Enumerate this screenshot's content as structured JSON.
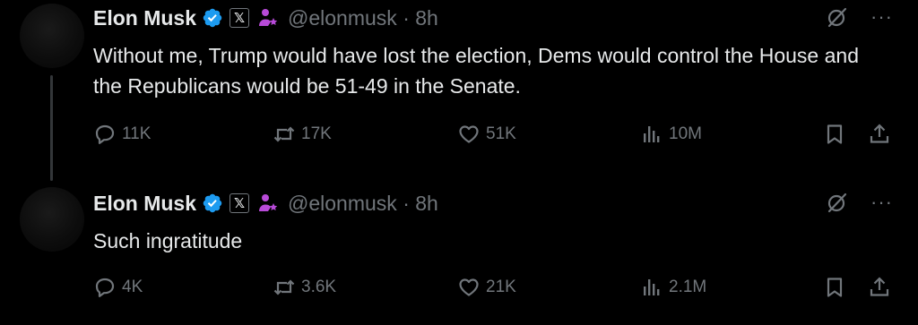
{
  "tweets": [
    {
      "author": "Elon Musk",
      "handle": "@elonmusk",
      "separator": "·",
      "time": "8h",
      "x_badge": "𝕏",
      "text": "Without me, Trump would have lost the election, Dems would control the House and the Republicans would be 51-49 in the Senate.",
      "replies": "11K",
      "retweets": "17K",
      "likes": "51K",
      "views": "10M"
    },
    {
      "author": "Elon Musk",
      "handle": "@elonmusk",
      "separator": "·",
      "time": "8h",
      "x_badge": "𝕏",
      "text": "Such ingratitude",
      "replies": "4K",
      "retweets": "3.6K",
      "likes": "21K",
      "views": "2.1M"
    }
  ],
  "icons": {
    "verified": "verified-check-icon",
    "affiliation": "affiliation-icon",
    "grok": "grok-icon",
    "more": "more-icon",
    "reply": "reply-icon",
    "retweet": "retweet-icon",
    "like": "heart-icon",
    "views": "views-icon",
    "bookmark": "bookmark-icon",
    "share": "share-icon"
  },
  "colors": {
    "background": "#000000",
    "text_primary": "#e7e9ea",
    "text_secondary": "#71767b",
    "verified_blue": "#1d9bf0",
    "affiliation_purple": "#b84ad8",
    "thread_line": "#333639"
  },
  "more_glyph": "···"
}
